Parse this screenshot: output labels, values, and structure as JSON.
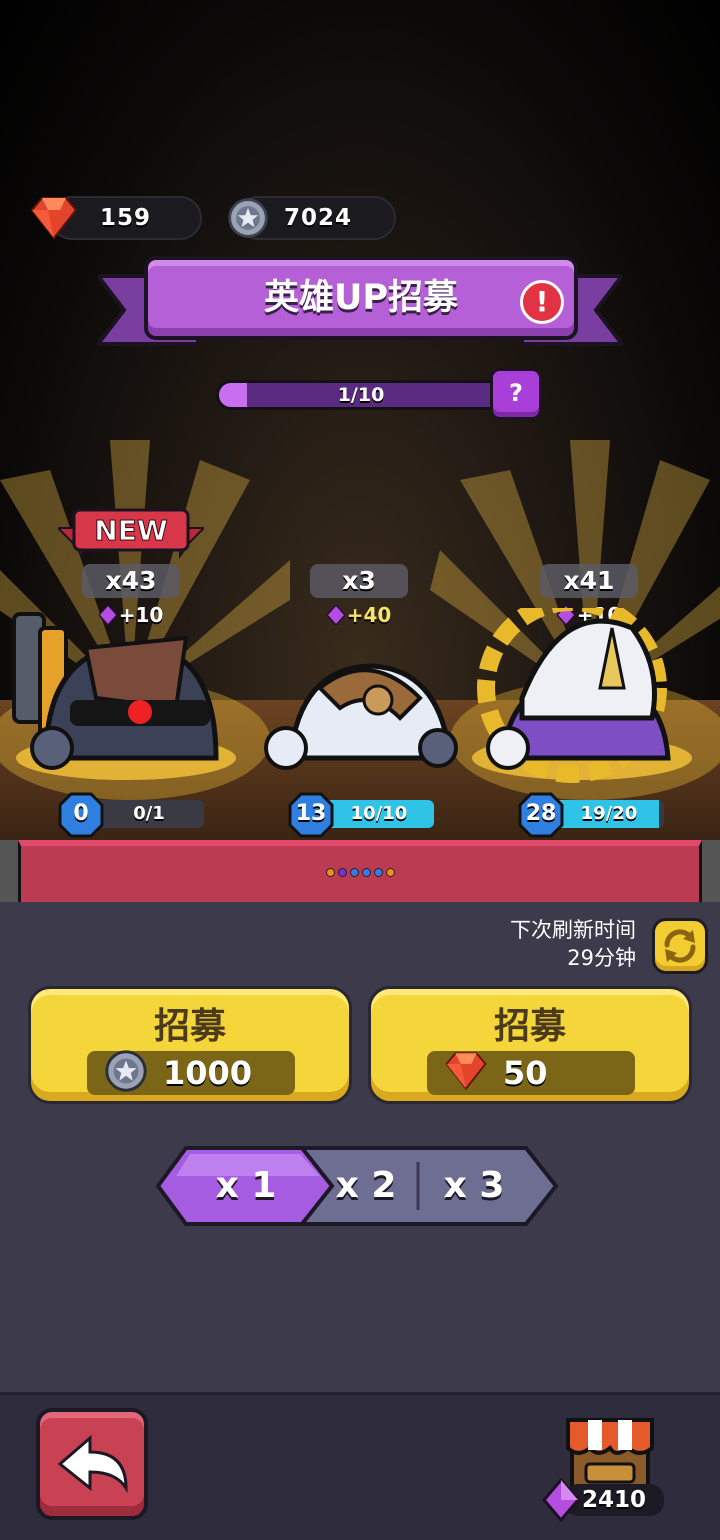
{
  "currency": {
    "ruby": "159",
    "coins": "7024"
  },
  "banner": {
    "title": "英雄UP招募",
    "alert_glyph": "!"
  },
  "progress": {
    "text": "1/10",
    "fraction": 0.1,
    "help_glyph": "?"
  },
  "new_tag": "NEW",
  "heroes": [
    {
      "count": "x43",
      "bonus": "+10",
      "level": "0",
      "progress_text": "0/1",
      "progress_fraction": 0.0
    },
    {
      "count": "x3",
      "bonus": "+40",
      "level": "13",
      "progress_text": "10/10",
      "progress_fraction": 1.0
    },
    {
      "count": "x41",
      "bonus": "+10",
      "level": "28",
      "progress_text": "19/20",
      "progress_fraction": 0.95
    }
  ],
  "refresh": {
    "line1": "下次刷新时间",
    "line2": "29分钟"
  },
  "recruit_buttons": [
    {
      "label": "招募",
      "cost": "1000",
      "currency_icon": "coin-icon"
    },
    {
      "label": "招募",
      "cost": "50",
      "currency_icon": "ruby-icon"
    }
  ],
  "multiplier": {
    "options": [
      "x 1",
      "x 2",
      "x 3"
    ],
    "selected_index": 0
  },
  "shop": {
    "gems": "2410"
  },
  "colors": {
    "accent_purple": "#b560d6",
    "button_yellow": "#f5d63a",
    "back_red": "#c84254",
    "level_cyan": "#2fc3e8"
  },
  "page_dots": [
    "#f28c1c",
    "#7a30d8",
    "#3b7ae8",
    "#3b7ae8",
    "#3b7ae8",
    "#f28c1c"
  ]
}
